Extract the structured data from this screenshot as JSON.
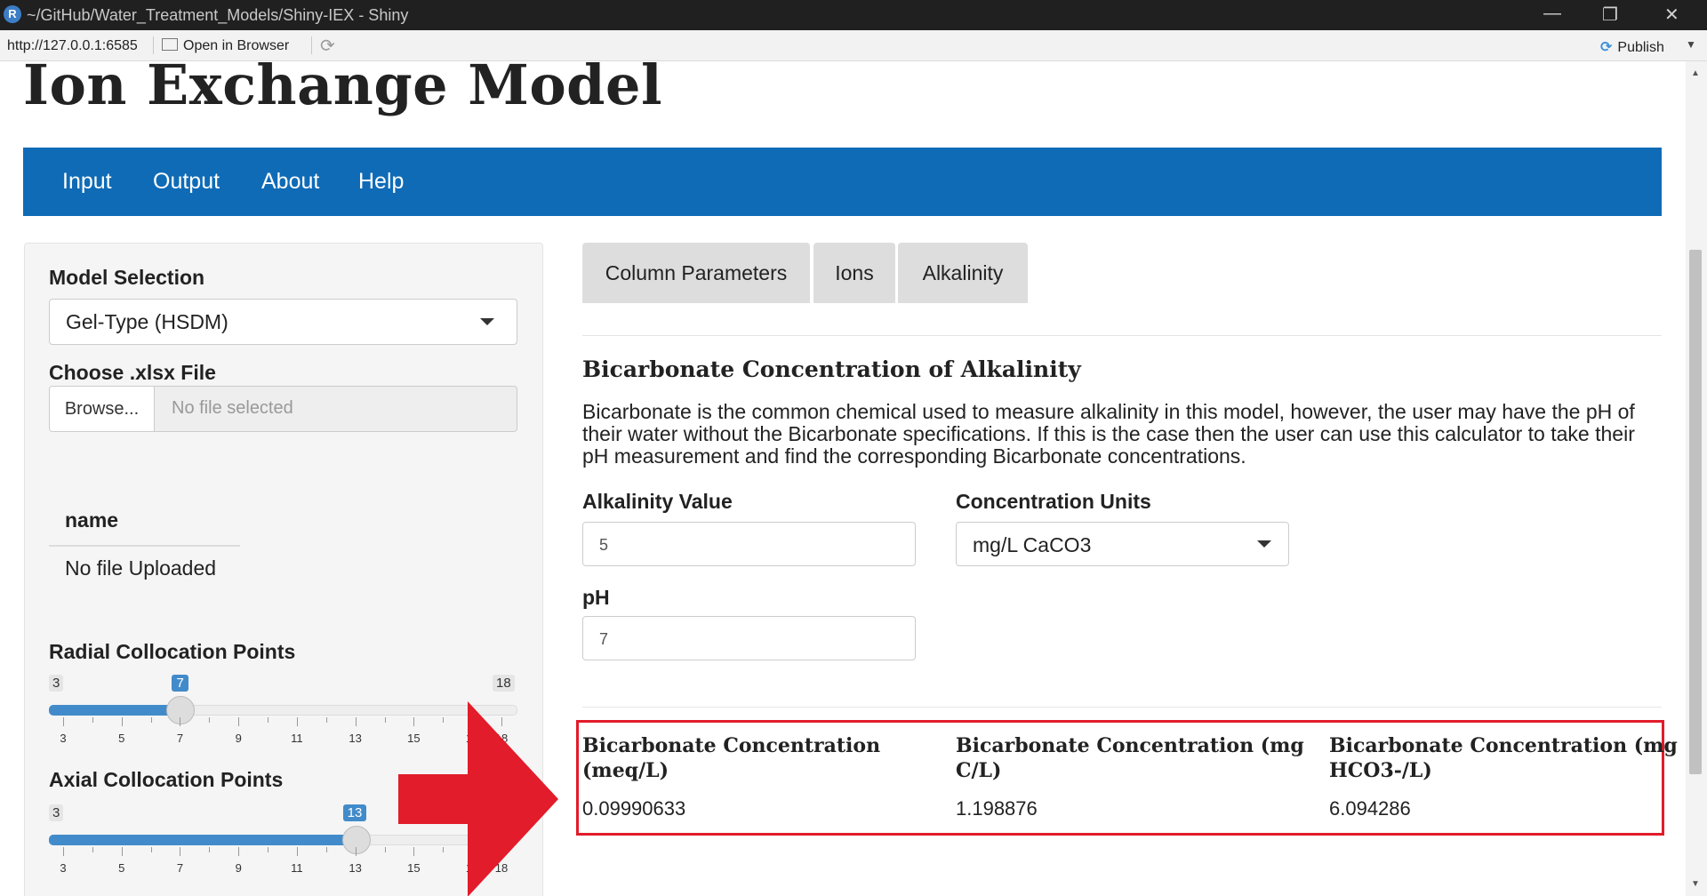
{
  "window": {
    "title": "~/GitHub/Water_Treatment_Models/Shiny-IEX - Shiny",
    "minimize": "—",
    "restore": "❐",
    "close": "✕"
  },
  "toolbar": {
    "url": "http://127.0.0.1:6585",
    "open_in_browser": "Open in Browser",
    "publish": "Publish"
  },
  "app": {
    "title": "Ion Exchange Model",
    "nav": [
      "Input",
      "Output",
      "About",
      "Help"
    ]
  },
  "sidebar": {
    "model_selection": {
      "label": "Model Selection",
      "value": "Gel-Type (HSDM)"
    },
    "file": {
      "label": "Choose .xlsx File",
      "button": "Browse...",
      "placeholder": "No file selected"
    },
    "table": {
      "header": "name",
      "cell": "No file Uploaded"
    },
    "radial": {
      "label": "Radial Collocation Points",
      "min": 3,
      "max": 18,
      "value": 7,
      "ticks": [
        "3",
        "5",
        "7",
        "9",
        "11",
        "13",
        "15",
        "17",
        "18"
      ]
    },
    "axial": {
      "label": "Axial Collocation Points",
      "min": 3,
      "max": 18,
      "value": 13,
      "ticks": [
        "3",
        "5",
        "7",
        "9",
        "11",
        "13",
        "15",
        "17",
        "18"
      ]
    }
  },
  "tabs": [
    "Column Parameters",
    "Ions",
    "Alkalinity"
  ],
  "alkalinity": {
    "heading": "Bicarbonate Concentration of Alkalinity",
    "description": "Bicarbonate is the common chemical used to measure alkalinity in this model, however, the user may have the pH of their water without the Bicarbonate specifications. If this is the case then the user can use this calculator to take their pH measurement and find the corresponding Bicarbonate concentrations.",
    "alkalinity_value": {
      "label": "Alkalinity Value",
      "value": "5"
    },
    "units": {
      "label": "Concentration Units",
      "value": "mg/L CaCO3"
    },
    "ph": {
      "label": "pH",
      "value": "7"
    },
    "results": [
      {
        "title_line1": "Bicarbonate Concentration",
        "title_line2": "(meq/L)",
        "value": "0.09990633"
      },
      {
        "title_line1": "Bicarbonate Concentration (mg",
        "title_line2": "C/L)",
        "value": "1.198876"
      },
      {
        "title_line1": "Bicarbonate Concentration (mg",
        "title_line2": "HCO3-/L)",
        "value": "6.094286"
      }
    ]
  },
  "colors": {
    "navbar": "#0f6bb6",
    "slider": "#428bca",
    "highlight_box": "#e21c2a",
    "arrow": "#e21c2a"
  }
}
